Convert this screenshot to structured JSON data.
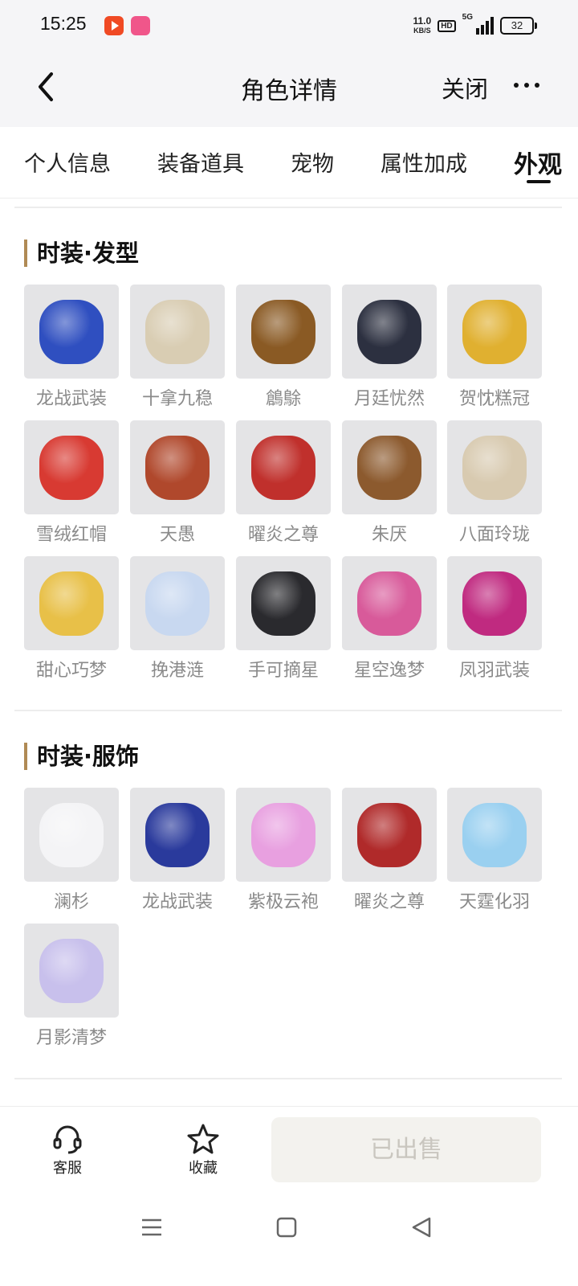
{
  "status_bar": {
    "time": "15:25",
    "speed_value": "11.0",
    "speed_unit": "KB/S",
    "hd": "HD",
    "network": "5G",
    "battery": "32"
  },
  "header": {
    "title": "角色详情",
    "close_label": "关闭"
  },
  "tabs": [
    {
      "label": "个人信息",
      "active": false
    },
    {
      "label": "装备道具",
      "active": false
    },
    {
      "label": "宠物",
      "active": false
    },
    {
      "label": "属性加成",
      "active": false
    },
    {
      "label": "外观",
      "active": true
    }
  ],
  "sections": [
    {
      "title": "时装·发型",
      "items": [
        {
          "name": "龙战武装",
          "color": "#2f4fc0"
        },
        {
          "name": "十拿九稳",
          "color": "#d9cdb3"
        },
        {
          "name": "鶬鵌",
          "color": "#8a5a24"
        },
        {
          "name": "月廷忧然",
          "color": "#2c3040"
        },
        {
          "name": "贺忱糕冠",
          "color": "#e0b030"
        },
        {
          "name": "雪绒红帽",
          "color": "#d83a32"
        },
        {
          "name": "天愚",
          "color": "#b0482c"
        },
        {
          "name": "曜炎之尊",
          "color": "#c0302c"
        },
        {
          "name": "朱厌",
          "color": "#8c5a2e"
        },
        {
          "name": "八面玲珑",
          "color": "#d8cab0"
        },
        {
          "name": "甜心巧梦",
          "color": "#e8c048"
        },
        {
          "name": "挽港涟",
          "color": "#c8d8f0"
        },
        {
          "name": "手可摘星",
          "color": "#2a2a2e"
        },
        {
          "name": "星空逸梦",
          "color": "#d85a9a"
        },
        {
          "name": "凤羽武装",
          "color": "#c02a80"
        }
      ]
    },
    {
      "title": "时装·服饰",
      "items": [
        {
          "name": "澜杉",
          "color": "#f4f4f6"
        },
        {
          "name": "龙战武装",
          "color": "#2a3a9c"
        },
        {
          "name": "紫极云袍",
          "color": "#e8a0e0"
        },
        {
          "name": "曜炎之尊",
          "color": "#b02a2a"
        },
        {
          "name": "天霆化羽",
          "color": "#9ad0f0"
        },
        {
          "name": "月影清梦",
          "color": "#c8c0ec"
        }
      ]
    }
  ],
  "bottom_bar": {
    "service_label": "客服",
    "favorite_label": "收藏",
    "sold_label": "已出售"
  }
}
